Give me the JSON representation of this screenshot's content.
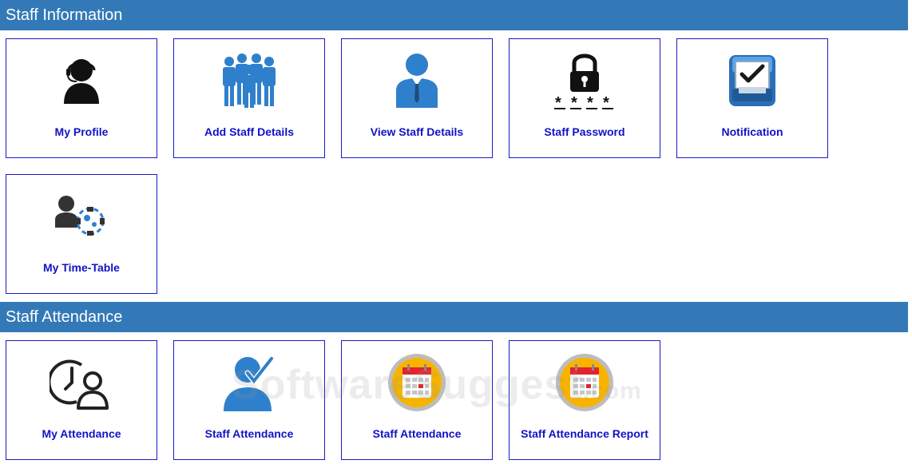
{
  "sections": {
    "info": {
      "title": "Staff Information",
      "tiles": [
        {
          "label": "My Profile",
          "icon": "profile-headset-icon"
        },
        {
          "label": "Add Staff Details",
          "icon": "staff-group-icon"
        },
        {
          "label": "View Staff Details",
          "icon": "staff-person-icon"
        },
        {
          "label": "Staff Password",
          "icon": "lock-password-icon"
        },
        {
          "label": "Notification",
          "icon": "notification-tray-icon"
        },
        {
          "label": "My Time-Table",
          "icon": "timetable-gear-icon"
        }
      ]
    },
    "attendance": {
      "title": "Staff Attendance",
      "tiles": [
        {
          "label": "My Attendance",
          "icon": "clock-user-icon"
        },
        {
          "label": "Staff Attendance",
          "icon": "person-check-icon"
        },
        {
          "label": "Staff Attendance",
          "icon": "calendar-icon"
        },
        {
          "label": "Staff Attendance Report",
          "icon": "calendar-report-icon"
        }
      ]
    }
  },
  "watermark": {
    "main": "SoftwareSuggest",
    "tld": ".com"
  },
  "colors": {
    "header": "#3379b7",
    "tile_border": "#1b1bc4",
    "label": "#1212c8",
    "icon_blue": "#2f80cc"
  }
}
